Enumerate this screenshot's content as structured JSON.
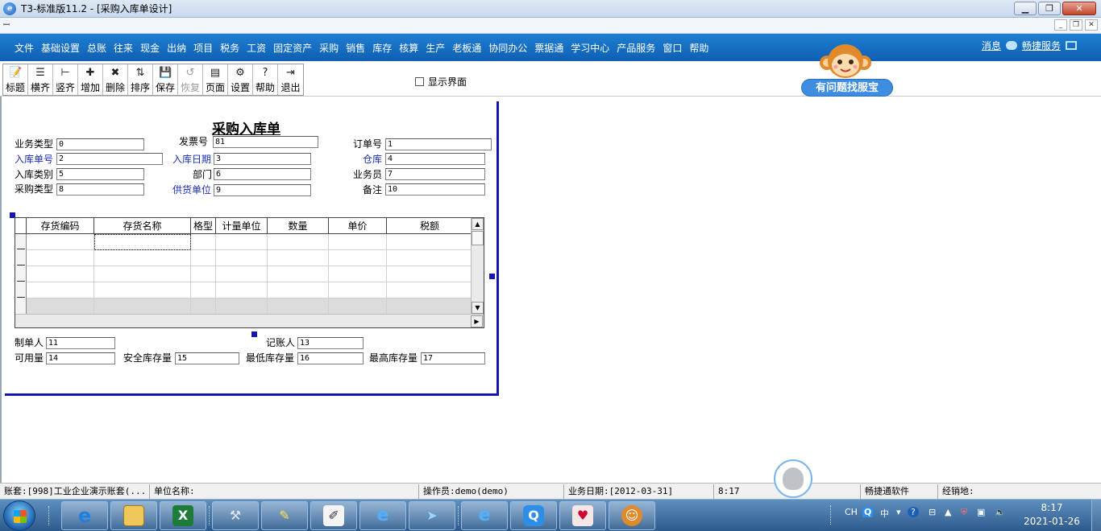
{
  "window": {
    "title": "T3-标准版11.2 - [采购入库单设计]",
    "min_btn": "▁",
    "max_btn": "❐",
    "close_btn": "✕"
  },
  "mdi": {
    "icon": "ꟷ",
    "min": "_",
    "restore": "❐",
    "close": "✕"
  },
  "menubar": {
    "items": [
      "文件",
      "基础设置",
      "总账",
      "往来",
      "现金",
      "出纳",
      "项目",
      "税务",
      "工资",
      "固定资产",
      "采购",
      "销售",
      "库存",
      "核算",
      "生产",
      "老板通",
      "协同办公",
      "票据通",
      "学习中心",
      "产品服务",
      "窗口",
      "帮助"
    ],
    "messages": "消息",
    "service": "畅捷服务"
  },
  "toolbar": {
    "buttons": [
      {
        "label": "标题",
        "icon": "📝",
        "disabled": false
      },
      {
        "label": "横齐",
        "icon": "☰",
        "disabled": false
      },
      {
        "label": "竖齐",
        "icon": "⊢",
        "disabled": false
      },
      {
        "label": "增加",
        "icon": "✚",
        "disabled": false
      },
      {
        "label": "删除",
        "icon": "✖",
        "disabled": false
      },
      {
        "label": "排序",
        "icon": "⇅",
        "disabled": false
      },
      {
        "label": "保存",
        "icon": "💾",
        "disabled": false
      },
      {
        "label": "恢复",
        "icon": "↺",
        "disabled": true
      },
      {
        "label": "页面",
        "icon": "▤",
        "disabled": false
      },
      {
        "label": "设置",
        "icon": "⚙",
        "disabled": false
      },
      {
        "label": "帮助",
        "icon": "?",
        "disabled": false
      },
      {
        "label": "退出",
        "icon": "⇥",
        "disabled": false
      }
    ],
    "show_ui_label": "显示界面"
  },
  "mascot": {
    "help_text": "有问题找服宝"
  },
  "form": {
    "title": "采购入库单",
    "header_fields": [
      {
        "label": "业务类型",
        "value": "0",
        "blue": false
      },
      {
        "label": "发票号",
        "value": "81",
        "blue": false
      },
      {
        "label": "订单号",
        "value": "1",
        "blue": false
      },
      {
        "label": "入库单号",
        "value": "2",
        "blue": true
      },
      {
        "label": "入库日期",
        "value": "3",
        "blue": true
      },
      {
        "label": "仓库",
        "value": "4",
        "blue": true
      },
      {
        "label": "入库类别",
        "value": "5",
        "blue": false
      },
      {
        "label": "部门",
        "value": "6",
        "blue": false
      },
      {
        "label": "业务员",
        "value": "7",
        "blue": false
      },
      {
        "label": "采购类型",
        "value": "8",
        "blue": false
      },
      {
        "label": "供货单位",
        "value": "9",
        "blue": true
      },
      {
        "label": "备注",
        "value": "10",
        "blue": false
      }
    ],
    "grid_columns": [
      "存货编码",
      "存货名称",
      "格型",
      "计量单位",
      "数量",
      "单价",
      "税额"
    ],
    "footer_fields": [
      {
        "label": "制单人",
        "value": "11"
      },
      {
        "label": "记账人",
        "value": "13"
      },
      {
        "label": "可用量",
        "value": "14"
      },
      {
        "label": "安全库存量",
        "value": "15"
      },
      {
        "label": "最低库存量",
        "value": "16"
      },
      {
        "label": "最高库存量",
        "value": "17"
      }
    ]
  },
  "statusbar": {
    "account": "账套:[998]工业企业演示账套(...",
    "unit": "单位名称:",
    "operator": "操作员:demo(demo)",
    "business_date": "业务日期:[2012-03-31]",
    "time": "8:17",
    "vendor": "畅捷通软件",
    "location": "经销地:"
  },
  "taskbar": {
    "tray_lang": "CH",
    "tray_ime": "中",
    "clock_time": "8:17",
    "clock_date": "2021-01-26"
  }
}
